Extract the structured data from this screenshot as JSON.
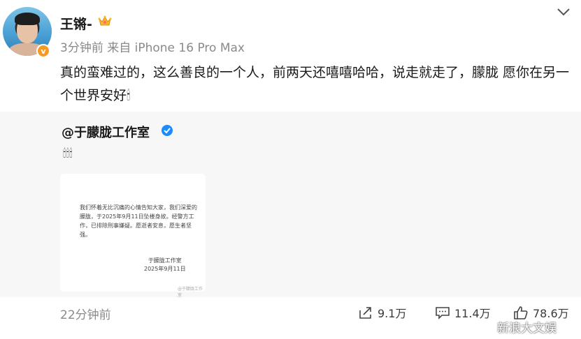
{
  "post": {
    "author": "王锵-",
    "meta": "3分钟前 来自 iPhone 16 Pro Max",
    "content": "真的蛮难过的，这么善良的一个人，前两天还嘻嘻哈哈，说走就走了，朦胧 愿你在另一个世界安好🕯",
    "time": "22分钟前"
  },
  "repost": {
    "author": "@于朦胧工作室",
    "candles": "🕯🕯🕯",
    "notice_body": "我们怀着无比沉痛的心情告知大家，我们深爱的朦胧，于2025年9月11日坠楼身故。经警方工作，已排除刑事嫌疑。愿逝者安息，愿生者坚强。",
    "notice_sign_name": "于朦胧工作室",
    "notice_sign_date": "2025年9月11日",
    "notice_watermark": "@于朦胧工作室"
  },
  "actions": {
    "share_count": "9.1万",
    "comment_count": "11.4万",
    "like_count": "78.6万"
  },
  "watermark": {
    "text": "新浪大文娱"
  },
  "colors": {
    "badge_orange": "#f59a23",
    "verified_blue": "#1a8cff",
    "muted_text": "#8a8a8a",
    "repost_bg": "#f7f7f7"
  },
  "icons": {
    "crown": "crown-icon",
    "chevron": "chevron-down-icon",
    "verified": "verified-icon",
    "share": "share-icon",
    "comment": "comment-icon",
    "like": "thumbs-up-icon",
    "weibo": "weibo-logo-icon"
  }
}
